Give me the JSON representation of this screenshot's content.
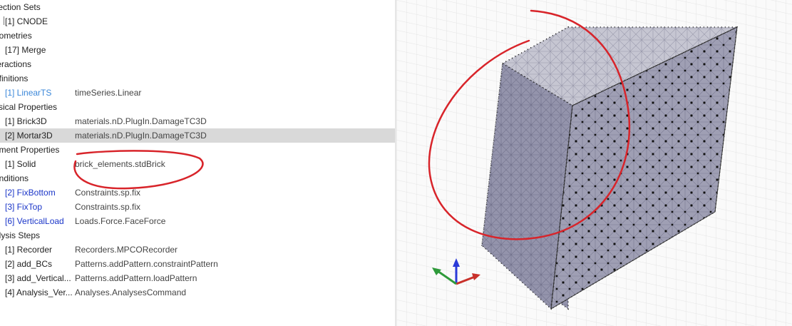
{
  "tree": {
    "rows": [
      {
        "kind": "header",
        "label": "llection Sets"
      },
      {
        "kind": "item",
        "label": "[1] CNODE",
        "type": "",
        "color": "dark",
        "stub": true
      },
      {
        "kind": "header",
        "label": "eometries"
      },
      {
        "kind": "item",
        "label": "[17] Merge",
        "type": "",
        "color": "dark"
      },
      {
        "kind": "header",
        "label": "teractions"
      },
      {
        "kind": "header",
        "label": "efinitions"
      },
      {
        "kind": "item",
        "label": "[1] LinearTS",
        "type": "timeSeries.Linear",
        "color": "light"
      },
      {
        "kind": "header",
        "label": "ysical Properties"
      },
      {
        "kind": "item",
        "label": "[1] Brick3D",
        "type": "materials.nD.PlugIn.DamageTC3D",
        "color": "dark"
      },
      {
        "kind": "item",
        "label": "[2] Mortar3D",
        "type": "materials.nD.PlugIn.DamageTC3D",
        "color": "dark",
        "selected": true
      },
      {
        "kind": "header",
        "label": "ement Properties"
      },
      {
        "kind": "item",
        "label": "[1] Solid",
        "type": "brick_elements.stdBrick",
        "color": "dark"
      },
      {
        "kind": "header",
        "label": "onditions"
      },
      {
        "kind": "item",
        "label": "[2] FixBottom",
        "type": "Constraints.sp.fix",
        "color": "blue"
      },
      {
        "kind": "item",
        "label": "[3] FixTop",
        "type": "Constraints.sp.fix",
        "color": "blue"
      },
      {
        "kind": "item",
        "label": "[6] VerticalLoad",
        "type": "Loads.Force.FaceForce",
        "color": "blue"
      },
      {
        "kind": "header",
        "label": "alysis Steps"
      },
      {
        "kind": "item",
        "label": "[1] Recorder",
        "type": "Recorders.MPCORecorder",
        "color": "dark"
      },
      {
        "kind": "item",
        "label": "[2] add_BCs",
        "type": "Patterns.addPattern.constraintPattern",
        "color": "dark"
      },
      {
        "kind": "item",
        "label": "[3] add_Vertical...",
        "type": "Patterns.addPattern.loadPattern",
        "color": "dark"
      },
      {
        "kind": "item",
        "label": "[4] Analysis_Ver...",
        "type": "Analyses.AnalysesCommand",
        "color": "dark"
      }
    ]
  },
  "colors": {
    "selection": "#d9d9d9",
    "link_light": "#3b87d9",
    "link_blue": "#1a35c8",
    "mesh_face": "#a4a4b8",
    "mesh_top": "#c8c8d2",
    "annotation": "#d8242a",
    "axis_x": "#c8302a",
    "axis_y": "#2e9a3a",
    "axis_z": "#2a3ad8"
  },
  "viewport": {
    "icons": [
      "axis-triad-icon"
    ]
  }
}
